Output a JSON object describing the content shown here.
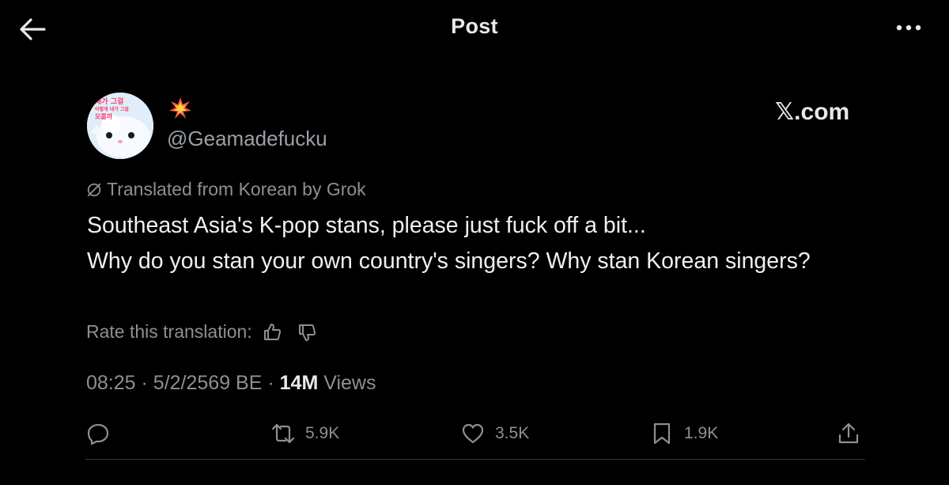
{
  "header": {
    "title": "Post",
    "back_icon": "arrow-left-icon",
    "more_icon": "more-horizontal-icon"
  },
  "author": {
    "avatar_text_line1": "내가 그걸",
    "avatar_text_line2": "어떻게 내가 그걸",
    "avatar_text_line3": "모를까",
    "display_name_emoji": "💥",
    "handle": "@Geamadefucku"
  },
  "brand": "𝕏.com",
  "translation": {
    "notice": "Translated from Korean by Grok",
    "rate_label": "Rate this translation:"
  },
  "post": {
    "line1": "Southeast Asia's K-pop stans, please just fuck off a bit...",
    "line2": "Why do you stan your own country's singers? Why stan Korean singers?"
  },
  "meta": {
    "time": "08:25",
    "separator": "·",
    "date": "5/2/2569 BE",
    "views_count": "14M",
    "views_label": "Views"
  },
  "actions": {
    "reply_count": "",
    "repost_count": "5.9K",
    "like_count": "3.5K",
    "bookmark_count": "1.9K"
  },
  "colors": {
    "background": "#000000",
    "primary_text": "#e7e9ea",
    "secondary_text": "#8b9096",
    "divider": "#2f3336"
  }
}
